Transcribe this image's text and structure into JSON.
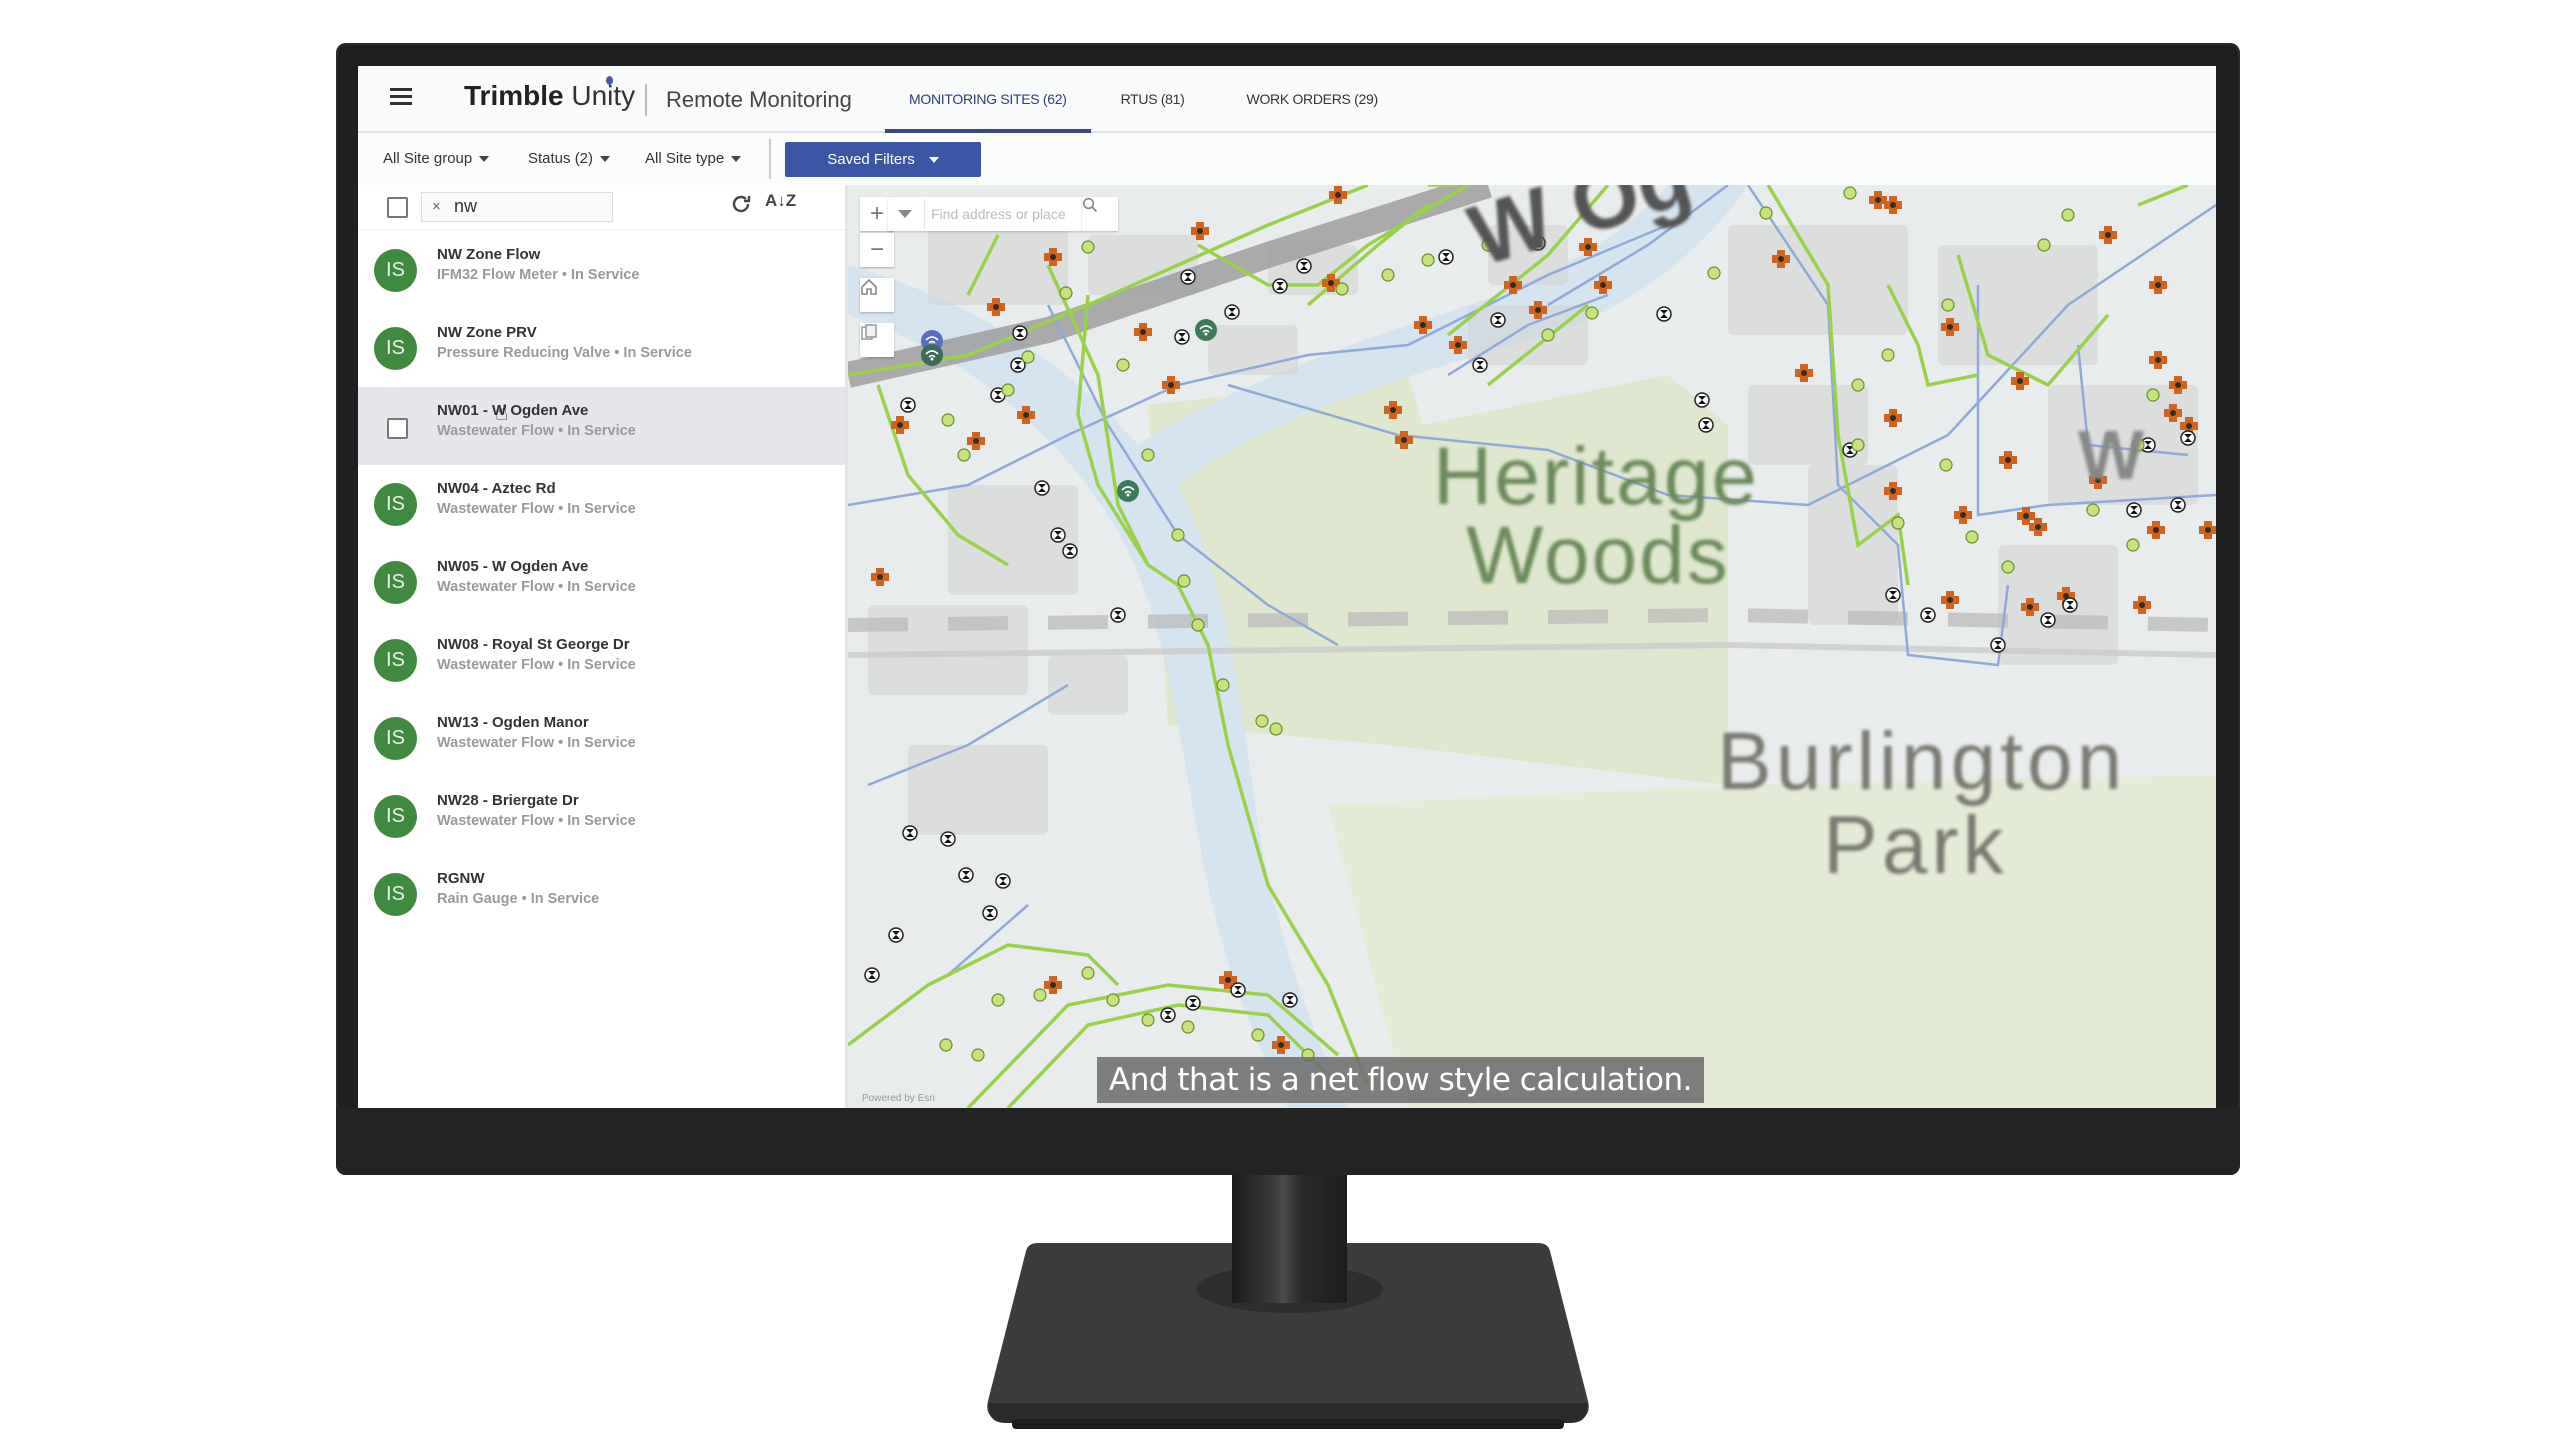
{
  "app": {
    "brand_primary": "Trimble",
    "brand_secondary": "Unity",
    "product": "Remote Monitoring",
    "menu_icon": "hamburger-menu-icon"
  },
  "tabs": [
    {
      "label": "MONITORING SITES (62)",
      "active": true
    },
    {
      "label": "RTUS (81)",
      "active": false
    },
    {
      "label": "WORK ORDERS (29)",
      "active": false
    }
  ],
  "filters": {
    "site_group": "All Site group",
    "status": "Status (2)",
    "site_type": "All Site type",
    "saved_filters": "Saved Filters"
  },
  "list_panel": {
    "search_value": "nw",
    "clear_icon": "×",
    "refresh_icon": "refresh-icon",
    "sort_icon": "A↓Z",
    "items": [
      {
        "avatar": "IS",
        "title": "NW Zone Flow",
        "subtitle": "IFM32 Flow Meter • In Service"
      },
      {
        "avatar": "IS",
        "title": "NW Zone PRV",
        "subtitle": "Pressure Reducing Valve • In Service"
      },
      {
        "avatar": "",
        "title": "NW01 - W Ogden Ave",
        "subtitle": "Wastewater Flow • In Service",
        "hovered": true
      },
      {
        "avatar": "IS",
        "title": "NW04 - Aztec Rd",
        "subtitle": "Wastewater Flow • In Service"
      },
      {
        "avatar": "IS",
        "title": "NW05 - W Ogden Ave",
        "subtitle": "Wastewater Flow • In Service"
      },
      {
        "avatar": "IS",
        "title": "NW08 - Royal St George Dr",
        "subtitle": "Wastewater Flow • In Service"
      },
      {
        "avatar": "IS",
        "title": "NW13 - Ogden Manor",
        "subtitle": "Wastewater Flow • In Service"
      },
      {
        "avatar": "IS",
        "title": "NW28 - Briergate Dr",
        "subtitle": "Wastewater Flow • In Service"
      },
      {
        "avatar": "IS",
        "title": "RGNW",
        "subtitle": "Rain Gauge • In Service"
      }
    ]
  },
  "map": {
    "search_placeholder": "Find address or place",
    "zoom_in": "+",
    "zoom_out": "−",
    "labels": {
      "road": "W Og",
      "road_right": "W",
      "park1_line1": "Heritage",
      "park1_line2": "Woods",
      "park2_line1": "Burlington",
      "park2_line2": "Park"
    },
    "attribution": "Powered by Esri"
  },
  "caption": "And that is a net flow style calculation.",
  "colors": {
    "accent": "#3a56a5",
    "tab_underline": "#3b4a7a",
    "avatar_green": "#3f8a3e",
    "pipe_green": "#9ad14b",
    "pipe_blue": "#8fa9d8",
    "manhole_orange": "#d0641e"
  }
}
